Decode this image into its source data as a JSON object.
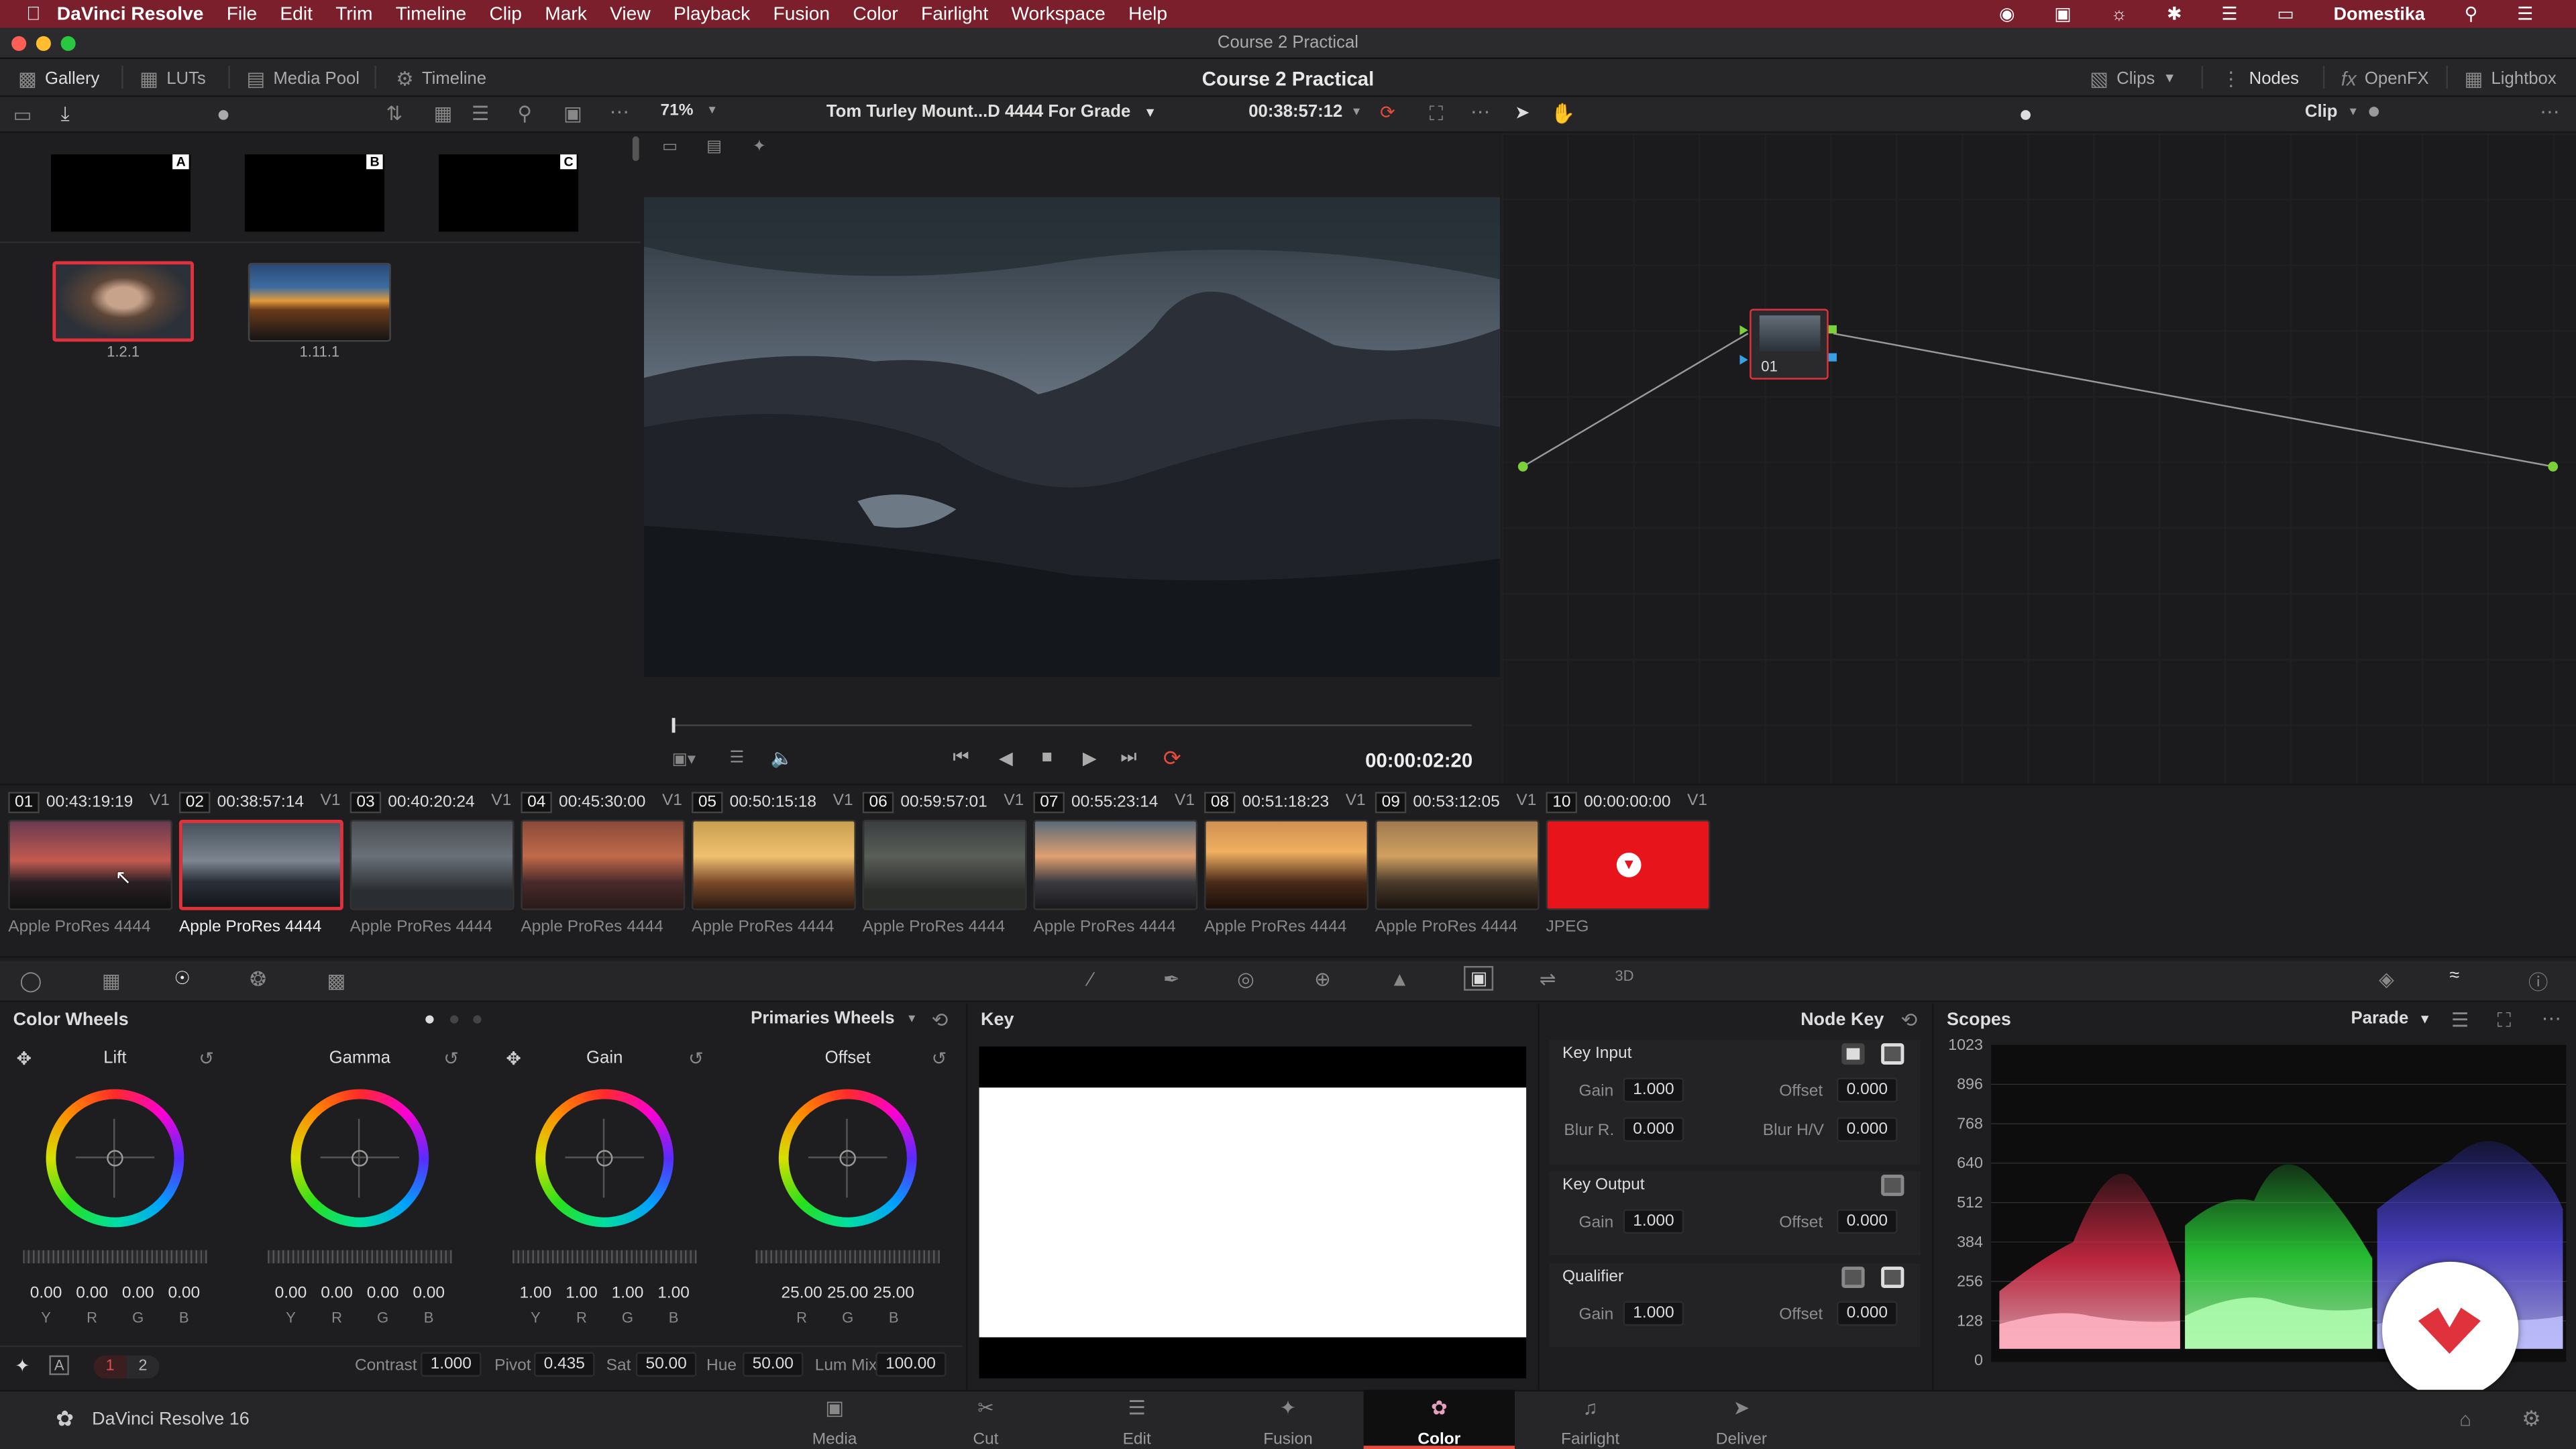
{
  "macmenu": {
    "app": "DaVinci Resolve",
    "items": [
      "File",
      "Edit",
      "Trim",
      "Timeline",
      "Clip",
      "Mark",
      "View",
      "Playback",
      "Fusion",
      "Color",
      "Fairlight",
      "Workspace",
      "Help"
    ],
    "user": "Domestika"
  },
  "window_title": "Course 2 Practical",
  "toolbar": {
    "gallery": "Gallery",
    "luts": "LUTs",
    "media_pool": "Media Pool",
    "timeline": "Timeline",
    "project_title": "Course 2 Practical",
    "clips": "Clips",
    "nodes": "Nodes",
    "openfx": "OpenFX",
    "lightbox": "Lightbox"
  },
  "viewer_bar": {
    "zoom": "71%",
    "clip_name": "Tom Turley Mount...D 4444 For Grade",
    "timecode": "00:38:57:12",
    "clip_mode": "Clip"
  },
  "gallery": {
    "memories": [
      "A",
      "B",
      "C"
    ],
    "stills": [
      {
        "label": "1.2.1",
        "selected": true
      },
      {
        "label": "1.11.1",
        "selected": false
      }
    ]
  },
  "transport": {
    "timecode": "00:00:02:20"
  },
  "node": {
    "label": "01"
  },
  "clips": [
    {
      "num": "01",
      "tc": "00:43:19:19",
      "track": "V1",
      "codec": "Apple ProRes 4444"
    },
    {
      "num": "02",
      "tc": "00:38:57:14",
      "track": "V1",
      "codec": "Apple ProRes 4444",
      "selected": true
    },
    {
      "num": "03",
      "tc": "00:40:20:24",
      "track": "V1",
      "codec": "Apple ProRes 4444"
    },
    {
      "num": "04",
      "tc": "00:45:30:00",
      "track": "V1",
      "codec": "Apple ProRes 4444"
    },
    {
      "num": "05",
      "tc": "00:50:15:18",
      "track": "V1",
      "codec": "Apple ProRes 4444"
    },
    {
      "num": "06",
      "tc": "00:59:57:01",
      "track": "V1",
      "codec": "Apple ProRes 4444"
    },
    {
      "num": "07",
      "tc": "00:55:23:14",
      "track": "V1",
      "codec": "Apple ProRes 4444"
    },
    {
      "num": "08",
      "tc": "00:51:18:23",
      "track": "V1",
      "codec": "Apple ProRes 4444"
    },
    {
      "num": "09",
      "tc": "00:53:12:05",
      "track": "V1",
      "codec": "Apple ProRes 4444"
    },
    {
      "num": "10",
      "tc": "00:00:00:00",
      "track": "V1",
      "codec": "JPEG"
    }
  ],
  "color_wheels": {
    "title": "Color Wheels",
    "mode": "Primaries Wheels",
    "wheels": [
      {
        "name": "Lift",
        "values": [
          "0.00",
          "0.00",
          "0.00",
          "0.00"
        ],
        "channels": [
          "Y",
          "R",
          "G",
          "B"
        ]
      },
      {
        "name": "Gamma",
        "values": [
          "0.00",
          "0.00",
          "0.00",
          "0.00"
        ],
        "channels": [
          "Y",
          "R",
          "G",
          "B"
        ]
      },
      {
        "name": "Gain",
        "values": [
          "1.00",
          "1.00",
          "1.00",
          "1.00"
        ],
        "channels": [
          "Y",
          "R",
          "G",
          "B"
        ]
      },
      {
        "name": "Offset",
        "values": [
          "25.00",
          "25.00",
          "25.00"
        ],
        "channels": [
          "R",
          "G",
          "B"
        ]
      }
    ],
    "pages": [
      "1",
      "2"
    ],
    "contrast_label": "Contrast",
    "contrast": "1.000",
    "pivot_label": "Pivot",
    "pivot": "0.435",
    "sat_label": "Sat",
    "sat": "50.00",
    "hue_label": "Hue",
    "hue": "50.00",
    "lummix_label": "Lum Mix",
    "lummix": "100.00"
  },
  "key_panel": {
    "title": "Key"
  },
  "node_key": {
    "title": "Node Key",
    "key_input": "Key Input",
    "key_output": "Key Output",
    "qualifier": "Qualifier",
    "gain_label": "Gain",
    "offset_label": "Offset",
    "blur_r_label": "Blur R.",
    "blur_hv_label": "Blur H/V",
    "input_gain": "1.000",
    "input_offset": "0.000",
    "blur_r": "0.000",
    "blur_hv": "0.000",
    "output_gain": "1.000",
    "output_offset": "0.000",
    "qual_gain": "1.000",
    "qual_offset": "0.000"
  },
  "scopes": {
    "title": "Scopes",
    "mode": "Parade",
    "axis": [
      "1023",
      "896",
      "768",
      "640",
      "512",
      "384",
      "256",
      "128",
      "0"
    ]
  },
  "bottom": {
    "app_name": "DaVinci Resolve 16",
    "tabs": [
      "Media",
      "Cut",
      "Edit",
      "Fusion",
      "Color",
      "Fairlight",
      "Deliver"
    ],
    "active_tab": "Color"
  },
  "colors": {
    "accent": "#e64b3b",
    "selection": "#e0323c",
    "menubar": "#7a1f2b"
  }
}
